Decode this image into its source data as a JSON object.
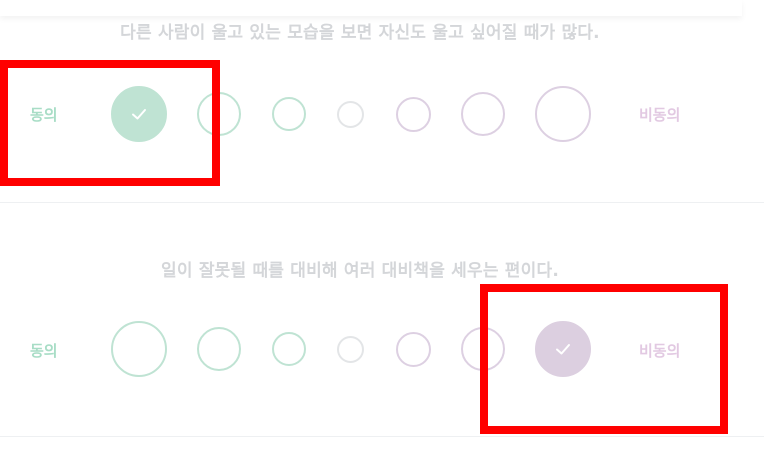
{
  "questions": [
    {
      "text": "다른 사람이 울고 있는 모습을 보면 자신도 울고 싶어질 때가 많다.",
      "agree_label": "동의",
      "disagree_label": "비동의",
      "selected_index": 0
    },
    {
      "text": "일이 잘못될 때를 대비해 여러 대비책을 세우는 편이다.",
      "agree_label": "동의",
      "disagree_label": "비동의",
      "selected_index": 6
    }
  ],
  "scale_points": 7,
  "colors": {
    "agree": "#bfe3d3",
    "neutral": "#e3e5e7",
    "disagree": "#ddd0e2",
    "agree_text": "#a8ddc6",
    "disagree_text": "#e2c9e2",
    "question_text": "#d4d6d9",
    "highlight": "#ff0000"
  },
  "icons": {
    "selected": "check-icon"
  }
}
